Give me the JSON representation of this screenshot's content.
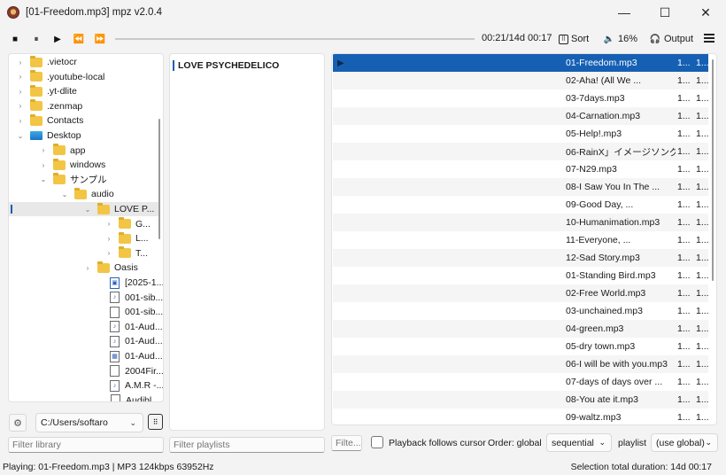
{
  "window": {
    "title": "[01-Freedom.mp3] mpz v2.0.4",
    "minimize": "—",
    "maximize": "☐",
    "close": "✕"
  },
  "toolbar": {
    "stop_icon": "■",
    "pause_icon": "⏸",
    "play_icon": "▶",
    "prev_icon": "⏪",
    "next_icon": "⏩",
    "time": "00:21/14d 00:17",
    "sort_label": "Sort",
    "volume_label": "16%",
    "output_label": "Output"
  },
  "tree": {
    "items": [
      {
        "label": ".vietocr",
        "chevron": "›",
        "type": "folder"
      },
      {
        "label": ".youtube-local",
        "chevron": "›",
        "type": "folder"
      },
      {
        "label": ".yt-dlite",
        "chevron": "›",
        "type": "folder"
      },
      {
        "label": ".zenmap",
        "chevron": "›",
        "type": "folder"
      },
      {
        "label": "Contacts",
        "chevron": "›",
        "type": "folder"
      },
      {
        "label": "Desktop",
        "chevron": "⌄",
        "type": "desktop"
      },
      {
        "label": "app",
        "chevron": "›",
        "type": "folder"
      },
      {
        "label": "windows",
        "chevron": "›",
        "type": "folder"
      },
      {
        "label": "サンプル",
        "chevron": "⌄",
        "type": "folder"
      },
      {
        "label": "audio",
        "chevron": "⌄",
        "type": "folder"
      },
      {
        "label": "LOVE P...",
        "chevron": "⌄",
        "type": "folder"
      },
      {
        "label": "G...",
        "chevron": "›",
        "type": "folder"
      },
      {
        "label": "L...",
        "chevron": "›",
        "type": "folder"
      },
      {
        "label": "T...",
        "chevron": "›",
        "type": "folder"
      },
      {
        "label": "Oasis",
        "chevron": "›",
        "type": "folder"
      },
      {
        "label": "[2025-1...",
        "chevron": "",
        "type": "file-img"
      },
      {
        "label": "001-sib...",
        "chevron": "",
        "type": "file-audio"
      },
      {
        "label": "001-sib...",
        "chevron": "",
        "type": "file"
      },
      {
        "label": "01-Aud...",
        "chevron": "",
        "type": "file-audio"
      },
      {
        "label": "01-Aud...",
        "chevron": "",
        "type": "file-audio"
      },
      {
        "label": "01-Aud...",
        "chevron": "",
        "type": "file-sheet"
      },
      {
        "label": "2004Fir...",
        "chevron": "",
        "type": "file"
      },
      {
        "label": "A.M.R -...",
        "chevron": "",
        "type": "file-audio"
      },
      {
        "label": "Audibl...",
        "chevron": "",
        "type": "file"
      }
    ]
  },
  "playlists": {
    "items": [
      {
        "label": "LOVE PSYCHEDELICO"
      }
    ]
  },
  "tracks": {
    "rows": [
      {
        "title": "01-Freedom.mp3",
        "c1": "1...",
        "c2": "1...",
        "playing": true
      },
      {
        "title": "02-Aha! (All We ...",
        "c1": "1...",
        "c2": "1..."
      },
      {
        "title": "03-7days.mp3",
        "c1": "1...",
        "c2": "1..."
      },
      {
        "title": "04-Carnation.mp3",
        "c1": "1...",
        "c2": "1..."
      },
      {
        "title": "05-Help!.mp3",
        "c1": "1...",
        "c2": "1..."
      },
      {
        "title": "06-RainX」イメージソング...",
        "c1": "1...",
        "c2": "1..."
      },
      {
        "title": "07-N29.mp3",
        "c1": "1...",
        "c2": "1..."
      },
      {
        "title": "08-I Saw You In The ...",
        "c1": "1...",
        "c2": "1..."
      },
      {
        "title": "09-Good Day, ...",
        "c1": "1...",
        "c2": "1..."
      },
      {
        "title": "10-Humanimation.mp3",
        "c1": "1...",
        "c2": "1..."
      },
      {
        "title": "11-Everyone, ...",
        "c1": "1...",
        "c2": "1..."
      },
      {
        "title": "12-Sad Story.mp3",
        "c1": "1...",
        "c2": "1..."
      },
      {
        "title": "01-Standing Bird.mp3",
        "c1": "1...",
        "c2": "1..."
      },
      {
        "title": "02-Free World.mp3",
        "c1": "1...",
        "c2": "1..."
      },
      {
        "title": "03-unchained.mp3",
        "c1": "1...",
        "c2": "1..."
      },
      {
        "title": "04-green.mp3",
        "c1": "1...",
        "c2": "1..."
      },
      {
        "title": "05-dry town.mp3",
        "c1": "1...",
        "c2": "1..."
      },
      {
        "title": "06-I will be with you.mp3",
        "c1": "1...",
        "c2": "1..."
      },
      {
        "title": "07-days of days over ...",
        "c1": "1...",
        "c2": "1..."
      },
      {
        "title": "08-You ate it.mp3",
        "c1": "1...",
        "c2": "1..."
      },
      {
        "title": "09-waltz.mp3",
        "c1": "1...",
        "c2": "1..."
      }
    ]
  },
  "bottom": {
    "path": "C:/Users/softaro",
    "filter_library": "Filter library",
    "filter_playlists": "Filter playlists",
    "filter_tracks": "Filte...",
    "follow_label": "Playback follows cursor",
    "order_label": "Order: global",
    "order_value": "sequential",
    "playlist_label": "playlist",
    "playlist_value": "(use global)"
  },
  "status": {
    "left": "Playing: 01-Freedom.mp3 | MP3 124kbps 63952Hz",
    "right": "Selection total duration: 14d 00:17"
  },
  "colors": {
    "selection": "#1660b4",
    "folder": "#f3c545"
  }
}
